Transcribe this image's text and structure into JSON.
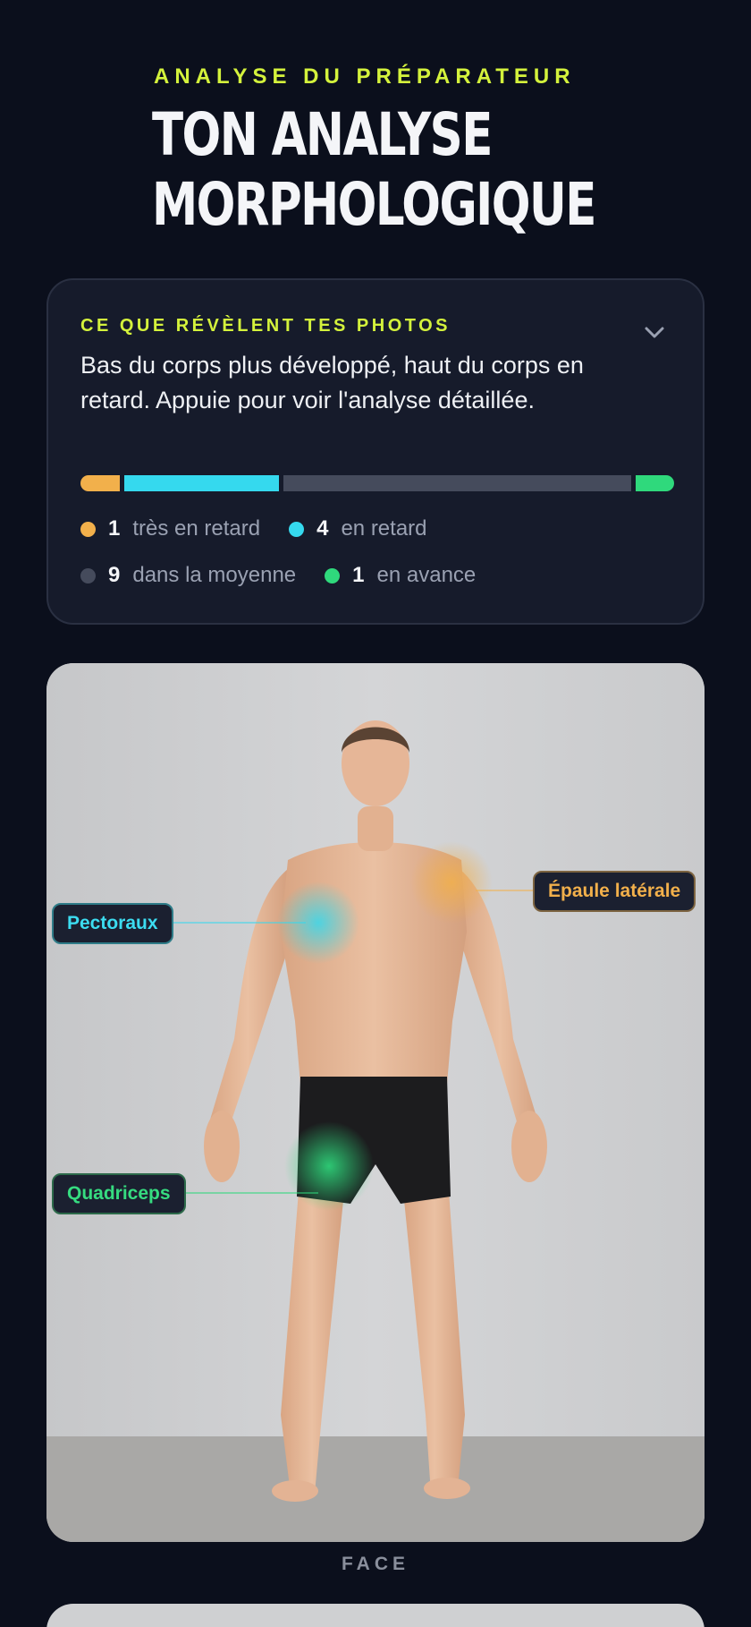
{
  "header": {
    "eyebrow": "ANALYSE DU PRÉPARATEUR",
    "title": "TON ANALYSE MORPHOLOGIQUE"
  },
  "summary": {
    "eyebrow": "CE QUE RÉVÈLENT TES PHOTOS",
    "text": "Bas du corps plus développé, haut du corps en retard. Appuie pour voir l'analyse détaillée.",
    "expand_icon": "chevron-down-icon",
    "legend": [
      {
        "count": "1",
        "label": "très en retard",
        "color": "#f2b04b"
      },
      {
        "count": "4",
        "label": "en retard",
        "color": "#35d9ee"
      },
      {
        "count": "9",
        "label": "dans la moyenne",
        "color": "#454b5c"
      },
      {
        "count": "1",
        "label": "en avance",
        "color": "#2fd97c"
      }
    ]
  },
  "photo": {
    "markers": [
      {
        "label": "Pectoraux",
        "color": "#35d9ee"
      },
      {
        "label": "Épaule latérale",
        "color": "#f2b04b"
      },
      {
        "label": "Quadriceps",
        "color": "#2fd97c"
      }
    ],
    "view_label": "FACE"
  }
}
